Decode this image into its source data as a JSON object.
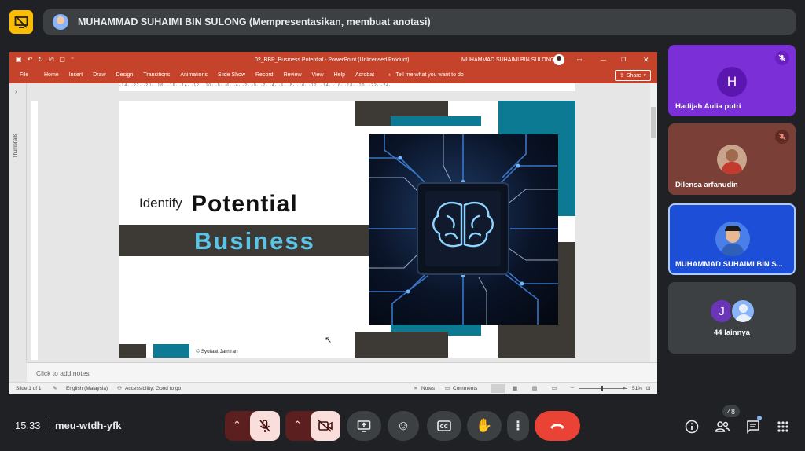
{
  "presenter_bar": {
    "text": "MUHAMMAD SUHAIMI BIN SULONG (Mempresentasikan, membuat anotasi)"
  },
  "powerpoint": {
    "window_title": "02_BBP_Business Potential  -  PowerPoint (Unlicensed Product)",
    "account_name": "MUHAMMAD SUHAIMI BIN SULONG",
    "ribbon_tabs": [
      "File",
      "Home",
      "Insert",
      "Draw",
      "Design",
      "Transitions",
      "Animations",
      "Slide Show",
      "Record",
      "Review",
      "View",
      "Help",
      "Acrobat"
    ],
    "tell_me": "Tell me what you want to do",
    "share_label": "Share",
    "thumbnails_label": "Thumbnails",
    "ruler_text": "·24· ·22· ·20· ·18· ·16· ·14· ·12· ·10· ·8· ·6· ·4· ·2· ·0· ·2· ·4· ·6· ·8· ·10· ·12· ·14· ·16· ·18· ·20· ·22· ·24·",
    "slide": {
      "identify": "Identify",
      "potential": "Potential",
      "business": "Business",
      "credit": "© Syufaat Jamiran"
    },
    "notes_placeholder": "Click to add notes",
    "status": {
      "slide": "Slide 1 of 1",
      "language": "English (Malaysia)",
      "accessibility": "Accessibility: Good to go",
      "notes": "Notes",
      "comments": "Comments",
      "zoom": "51%"
    }
  },
  "participants": [
    {
      "name": "Hadijah Aulia putri",
      "initial": "H",
      "bg": "#7b2fd6",
      "avatar_bg": "#6a1fc0",
      "muted": true
    },
    {
      "name": "Dilensa arfanudin",
      "initial": "",
      "bg": "#7a4038",
      "avatar_bg": "#c9a58e",
      "muted": true
    },
    {
      "name": "MUHAMMAD SUHAIMI BIN S...",
      "initial": "",
      "bg": "#1d4ed8",
      "avatar_bg": "#4a7ee8",
      "muted": false
    },
    {
      "name": "44 lainnya",
      "initial": "J",
      "bg": "#3c4043",
      "avatar_bg": "#6b35b8",
      "muted": false
    }
  ],
  "bottom": {
    "clock": "15.33",
    "meeting_code": "meu-wtdh-yfk",
    "people_count": "48"
  },
  "colors": {
    "accent_teal": "#0d7a94",
    "slide_dark": "#3d3935",
    "business_blue": "#5bc4e6",
    "ppt_red": "#c5432a",
    "end_call": "#ea4335"
  }
}
